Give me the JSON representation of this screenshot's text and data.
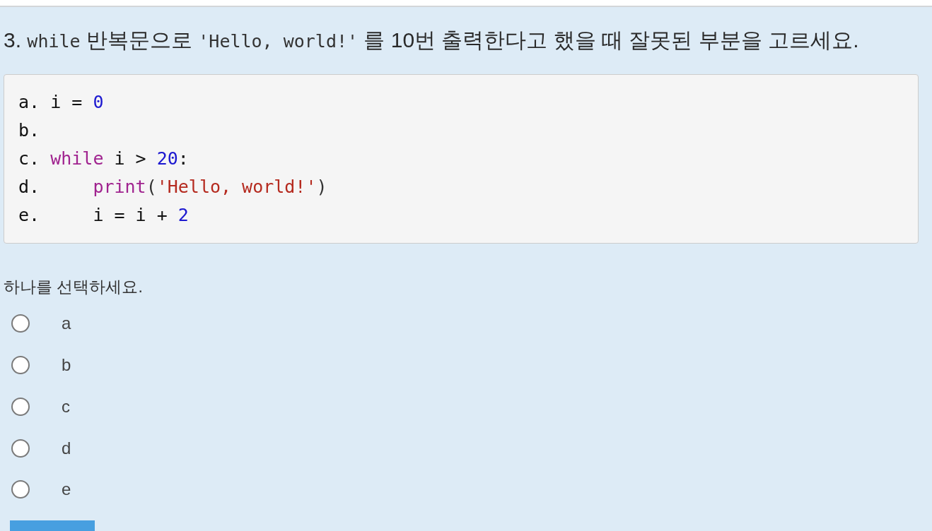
{
  "question": {
    "title": [
      {
        "kind": "text",
        "text": "3. "
      },
      {
        "kind": "code",
        "text": "while"
      },
      {
        "kind": "text",
        "text": " 반복문으로 "
      },
      {
        "kind": "code",
        "text": "'Hello, world!'"
      },
      {
        "kind": "text",
        "text": " 를 10번 출력한다고 했을 때 잘못된 부분을 고르세요."
      }
    ],
    "code_block": {
      "lines": [
        {
          "label": "a.",
          "tokens": [
            {
              "kind": "plain",
              "text": "i = "
            },
            {
              "kind": "number",
              "text": "0"
            }
          ]
        },
        {
          "label": "b."
        },
        {
          "label": "c.",
          "tokens": [
            {
              "kind": "keyword",
              "text": "while"
            },
            {
              "kind": "plain",
              "text": " i > "
            },
            {
              "kind": "number",
              "text": "20"
            },
            {
              "kind": "plain",
              "text": ":"
            }
          ]
        },
        {
          "label": "d.",
          "tokens": [
            {
              "kind": "keyword",
              "text": "    print"
            },
            {
              "kind": "punct",
              "text": "("
            },
            {
              "kind": "string",
              "text": "'Hello, world!'"
            },
            {
              "kind": "punct",
              "text": ")"
            }
          ]
        },
        {
          "label": "e.",
          "tokens": [
            {
              "kind": "plain",
              "text": "    i = i + "
            },
            {
              "kind": "number",
              "text": "2"
            }
          ]
        }
      ]
    },
    "instruction": "하나를 선택하세요.",
    "options": [
      {
        "label": "a",
        "selected": false
      },
      {
        "label": "b",
        "selected": false
      },
      {
        "label": "c",
        "selected": false
      },
      {
        "label": "d",
        "selected": false
      },
      {
        "label": "e",
        "selected": false
      }
    ]
  }
}
